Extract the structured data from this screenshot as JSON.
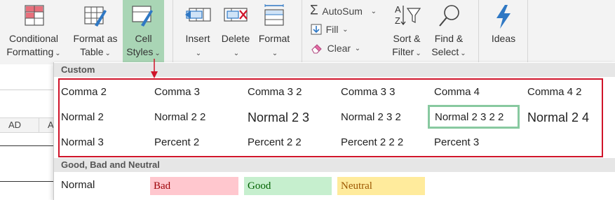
{
  "ribbon": {
    "conditional_formatting": {
      "line1": "Conditional",
      "line2": "Formatting"
    },
    "format_as_table": {
      "line1": "Format as",
      "line2": "Table"
    },
    "cell_styles": {
      "line1": "Cell",
      "line2": "Styles"
    },
    "insert": "Insert",
    "delete": "Delete",
    "format": "Format",
    "autosum": "AutoSum",
    "fill": "Fill",
    "clear": "Clear",
    "sort_filter": {
      "line1": "Sort &",
      "line2": "Filter"
    },
    "find_select": {
      "line1": "Find &",
      "line2": "Select"
    },
    "ideas": "Ideas"
  },
  "sheet": {
    "col_ad": "AD",
    "col_partial": "A"
  },
  "gallery": {
    "custom_header": "Custom",
    "custom_styles": [
      [
        "Comma 2",
        "Comma 3",
        "Comma 3 2",
        "Comma 3 3",
        "Comma 4",
        "Comma 4 2"
      ],
      [
        "Normal 2",
        "Normal 2 2",
        "Normal 2 3",
        "Normal 2 3 2",
        "Normal 2 3 2 2",
        "Normal 2 4"
      ],
      [
        "Normal 3",
        "Percent 2",
        "Percent 2 2",
        "Percent 2 2 2",
        "Percent 3"
      ]
    ],
    "gbn_header": "Good, Bad and Neutral",
    "gbn_styles": [
      "Normal",
      "Bad",
      "Good",
      "Neutral"
    ]
  },
  "colors": {
    "highlight": "#a9d5b5",
    "annotation": "#d0142a",
    "bad_bg": "#ffc7ce",
    "bad_fg": "#9c0006",
    "good_bg": "#c6efce",
    "good_fg": "#006100",
    "neutral_bg": "#ffeb9c",
    "neutral_fg": "#9c5700",
    "selected_border": "#88c9a0"
  }
}
